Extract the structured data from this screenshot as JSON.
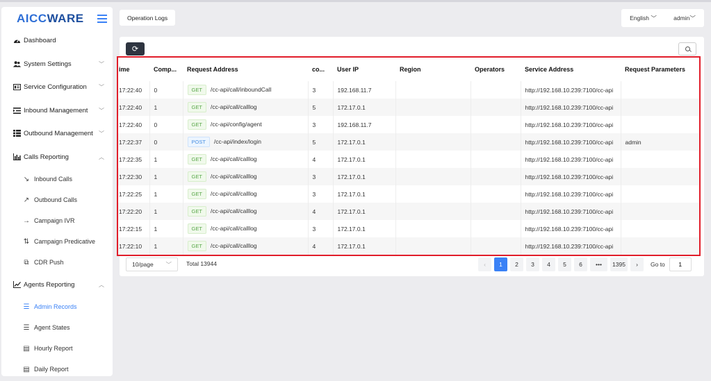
{
  "logo": {
    "part1": "AICC",
    "part2": "WARE"
  },
  "sidebar": {
    "items": [
      {
        "label": "Dashboard",
        "icon": "dashboard-icon"
      },
      {
        "label": "System Settings",
        "icon": "users-icon"
      },
      {
        "label": "Service Configuration",
        "icon": "service-icon"
      },
      {
        "label": "Inbound Management",
        "icon": "inbound-icon"
      },
      {
        "label": "Outbound Management",
        "icon": "outbound-icon"
      },
      {
        "label": "Calls Reporting",
        "icon": "bar-chart-icon"
      },
      {
        "label": "Agents Reporting",
        "icon": "line-chart-icon"
      }
    ],
    "calls_sub": [
      {
        "label": "Inbound Calls",
        "icon": "arrow-down-right-icon"
      },
      {
        "label": "Outbound Calls",
        "icon": "arrow-up-right-icon"
      },
      {
        "label": "Campaign IVR",
        "icon": "arrow-right-icon"
      },
      {
        "label": "Campaign Predicative",
        "icon": "split-arrows-icon"
      },
      {
        "label": "CDR Push",
        "icon": "copy-icon"
      }
    ],
    "agents_sub": [
      {
        "label": "Admin Records",
        "icon": "sliders-icon",
        "active": true
      },
      {
        "label": "Agent States",
        "icon": "sliders-icon"
      },
      {
        "label": "Hourly Report",
        "icon": "document-icon"
      },
      {
        "label": "Daily Report",
        "icon": "document-icon"
      }
    ]
  },
  "tab": {
    "label": "Operation Logs"
  },
  "topbar": {
    "language": "English",
    "user": "admin"
  },
  "table": {
    "headers": [
      "ime",
      "Comp...",
      "Request Address",
      "co...",
      "User IP",
      "Region",
      "Operators",
      "Service Address",
      "Request Parameters"
    ],
    "rows": [
      {
        "time": "17:22:40",
        "comp": "0",
        "method": "GET",
        "path": "/cc-api/call/inboundCall",
        "co": "3",
        "ip": "192.168.11.7",
        "region": "",
        "operators": "",
        "service": "http://192.168.10.239:7100/cc-api",
        "params": ""
      },
      {
        "time": "17:22:40",
        "comp": "1",
        "method": "GET",
        "path": "/cc-api/call/calllog",
        "co": "5",
        "ip": "172.17.0.1",
        "region": "",
        "operators": "",
        "service": "http://192.168.10.239:7100/cc-api",
        "params": ""
      },
      {
        "time": "17:22:40",
        "comp": "0",
        "method": "GET",
        "path": "/cc-api/config/agent",
        "co": "3",
        "ip": "192.168.11.7",
        "region": "",
        "operators": "",
        "service": "http://192.168.10.239:7100/cc-api",
        "params": ""
      },
      {
        "time": "17:22:37",
        "comp": "0",
        "method": "POST",
        "path": "/cc-api/index/login",
        "co": "5",
        "ip": "172.17.0.1",
        "region": "",
        "operators": "",
        "service": "http://192.168.10.239:7100/cc-api",
        "params": "admin"
      },
      {
        "time": "17:22:35",
        "comp": "1",
        "method": "GET",
        "path": "/cc-api/call/calllog",
        "co": "4",
        "ip": "172.17.0.1",
        "region": "",
        "operators": "",
        "service": "http://192.168.10.239:7100/cc-api",
        "params": ""
      },
      {
        "time": "17:22:30",
        "comp": "1",
        "method": "GET",
        "path": "/cc-api/call/calllog",
        "co": "3",
        "ip": "172.17.0.1",
        "region": "",
        "operators": "",
        "service": "http://192.168.10.239:7100/cc-api",
        "params": ""
      },
      {
        "time": "17:22:25",
        "comp": "1",
        "method": "GET",
        "path": "/cc-api/call/calllog",
        "co": "3",
        "ip": "172.17.0.1",
        "region": "",
        "operators": "",
        "service": "http://192.168.10.239:7100/cc-api",
        "params": ""
      },
      {
        "time": "17:22:20",
        "comp": "1",
        "method": "GET",
        "path": "/cc-api/call/calllog",
        "co": "4",
        "ip": "172.17.0.1",
        "region": "",
        "operators": "",
        "service": "http://192.168.10.239:7100/cc-api",
        "params": ""
      },
      {
        "time": "17:22:15",
        "comp": "1",
        "method": "GET",
        "path": "/cc-api/call/calllog",
        "co": "3",
        "ip": "172.17.0.1",
        "region": "",
        "operators": "",
        "service": "http://192.168.10.239:7100/cc-api",
        "params": ""
      },
      {
        "time": "17:22:10",
        "comp": "1",
        "method": "GET",
        "path": "/cc-api/call/calllog",
        "co": "4",
        "ip": "172.17.0.1",
        "region": "",
        "operators": "",
        "service": "http://192.168.10.239:7100/cc-api",
        "params": ""
      }
    ]
  },
  "pagination": {
    "page_size": "10/page",
    "total": "Total 13944",
    "pages": [
      "1",
      "2",
      "3",
      "4",
      "5",
      "6",
      "•••",
      "1395"
    ],
    "current": "1",
    "goto_label": "Go to",
    "goto_value": "1"
  },
  "colors": {
    "accent": "#3b82f6",
    "highlight_border": "#e11d2a",
    "refresh_button": "#2e3440"
  }
}
